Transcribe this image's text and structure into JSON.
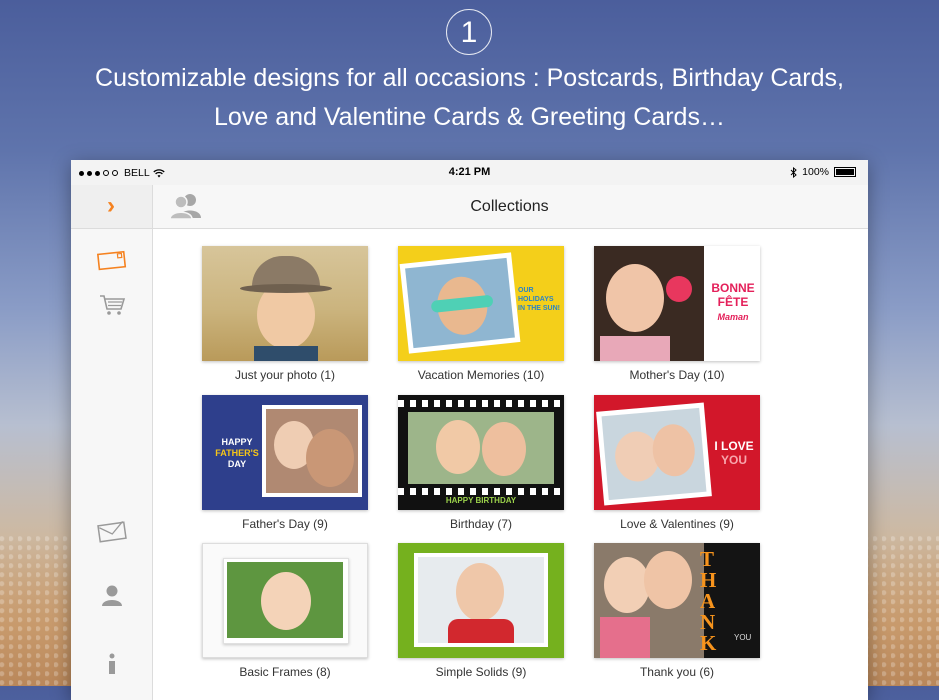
{
  "promo": {
    "step": "1",
    "headline_line1": "Customizable designs for all occasions : Postcards, Birthday Cards,",
    "headline_line2": "Love and Valentine Cards & Greeting Cards…"
  },
  "statusbar": {
    "carrier": "BELL",
    "time": "4:21 PM",
    "battery": "100%"
  },
  "navbar": {
    "title": "Collections"
  },
  "sidebar": {
    "items": [
      {
        "icon": "chevron-right-icon"
      },
      {
        "icon": "postcard-icon"
      },
      {
        "icon": "cart-icon"
      },
      {
        "icon": "mail-icon"
      },
      {
        "icon": "user-icon"
      },
      {
        "icon": "info-icon"
      }
    ],
    "accent": "#f58220"
  },
  "collections": [
    {
      "label": "Just your photo (1)"
    },
    {
      "label": "Vacation Memories (10)",
      "card_text": "OUR HOLIDAYS IN THE SUN!"
    },
    {
      "label": "Mother's Day (10)",
      "card_text_1": "BONNE",
      "card_text_2": "FÊTE",
      "card_text_3": "Maman"
    },
    {
      "label": "Father's Day (9)",
      "card_text_1": "HAPPY",
      "card_text_2": "FATHER'S",
      "card_text_3": "DAY"
    },
    {
      "label": "Birthday (7)",
      "card_text": "HAPPY BIRTHDAY"
    },
    {
      "label": "Love & Valentines (9)",
      "card_text_1": "I LOVE",
      "card_text_2": "YOU"
    },
    {
      "label": "Basic Frames (8)"
    },
    {
      "label": "Simple Solids (9)"
    },
    {
      "label": "Thank you (6)",
      "card_text_1": "THANK",
      "card_text_2": "YOU"
    }
  ]
}
